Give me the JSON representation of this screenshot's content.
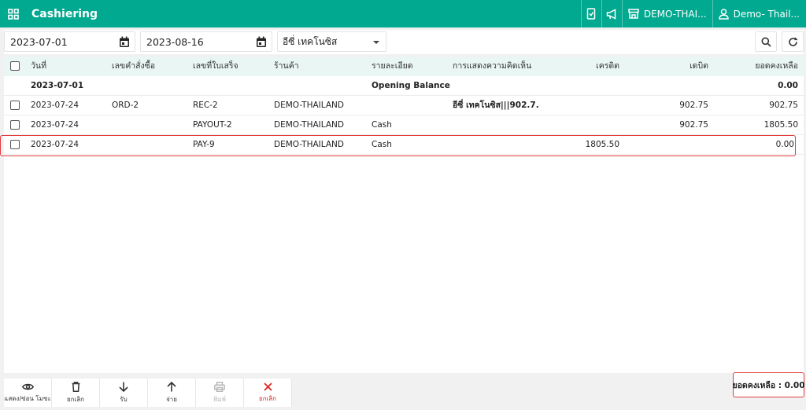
{
  "header": {
    "title": "Cashiering",
    "store_button": "DEMO-THAI...",
    "user_button": "Demo- Thail..."
  },
  "filters": {
    "date_from": "2023-07-01",
    "date_to": "2023-08-16",
    "customer": "อีซี่ เทคโนซิส"
  },
  "table": {
    "columns": [
      "วันที่",
      "เลขคำสั่งซื้อ",
      "เลขที่ใบเสร็จ",
      "ร้านค้า",
      "รายละเอียด",
      "การแสดงความคิดเห็น",
      "เครดิต",
      "เดบิต",
      "ยอดคงเหลือ"
    ],
    "rows": [
      {
        "date": "2023-07-01",
        "order": "",
        "receipt": "",
        "store": "",
        "detail": "Opening Balance",
        "comment": "",
        "credit": "",
        "debit": "",
        "balance": "0.00"
      },
      {
        "date": "2023-07-24",
        "order": "ORD-2",
        "receipt": "REC-2",
        "store": "DEMO-THAILAND",
        "detail": "",
        "comment": "อีซี่ เทคโนซิส|||902.7...",
        "credit": "",
        "debit": "902.75",
        "balance": "902.75"
      },
      {
        "date": "2023-07-24",
        "order": "",
        "receipt": "PAYOUT-2",
        "store": "DEMO-THAILAND",
        "detail": "Cash",
        "comment": "",
        "credit": "",
        "debit": "902.75",
        "balance": "1805.50"
      },
      {
        "date": "2023-07-24",
        "order": "",
        "receipt": "PAY-9",
        "store": "DEMO-THAILAND",
        "detail": "Cash",
        "comment": "",
        "credit": "1805.50",
        "debit": "",
        "balance": "0.00"
      }
    ]
  },
  "actions": {
    "show_hide_label": "แสดง/ซ่อน โมซะ",
    "delete_label": "ยกเลิก",
    "receive_label": "รับ",
    "pay_label": "จ่าย",
    "print_label": "พิมพ์",
    "cancel_label": "ยกเลิก"
  },
  "summary": {
    "balance_text": "ยอดคงเหลือ : 0.00"
  },
  "colors": {
    "brand": "#00a98f",
    "table_header_bg": "#e9f6f3",
    "highlight": "#e23b3b",
    "danger": "#e02424"
  },
  "icons": [
    "apps-grid-icon",
    "mobile-payment-icon",
    "megaphone-icon",
    "store-icon",
    "user-icon",
    "calendar-icon",
    "search-icon",
    "refresh-icon",
    "eye-icon",
    "trash-icon",
    "arrow-down-icon",
    "arrow-up-icon",
    "printer-icon",
    "close-icon"
  ]
}
